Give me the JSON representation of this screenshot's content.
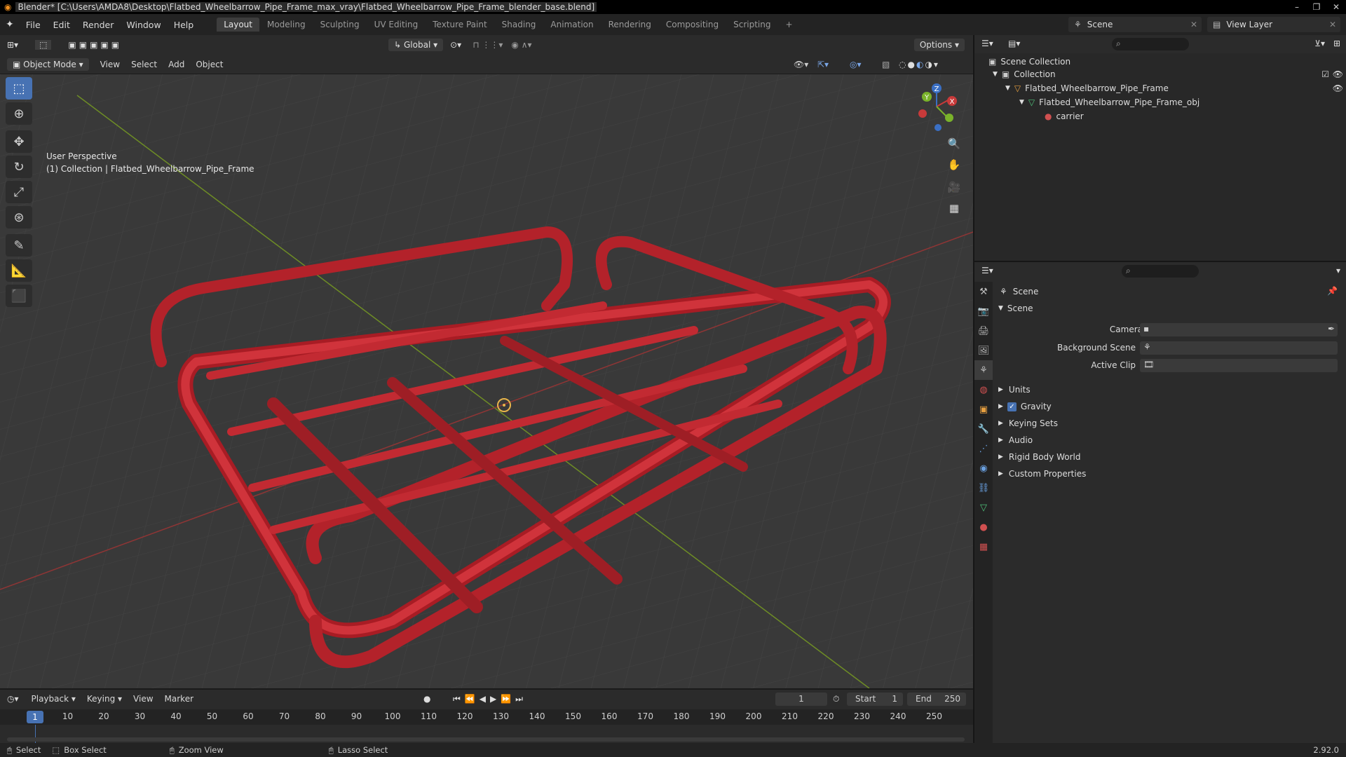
{
  "window": {
    "title": "Blender* [C:\\Users\\AMDA8\\Desktop\\Flatbed_Wheelbarrow_Pipe_Frame_max_vray\\Flatbed_Wheelbarrow_Pipe_Frame_blender_base.blend]",
    "buttons": [
      "–",
      "❐",
      "✕"
    ]
  },
  "menu": {
    "items": [
      "File",
      "Edit",
      "Render",
      "Window",
      "Help"
    ],
    "workspaces": [
      "Layout",
      "Modeling",
      "Sculpting",
      "UV Editing",
      "Texture Paint",
      "Shading",
      "Animation",
      "Rendering",
      "Compositing",
      "Scripting"
    ],
    "add_workspace": "+"
  },
  "scene_selector": {
    "value": "Scene"
  },
  "view_layer_selector": {
    "value": "View Layer"
  },
  "toolbar": {
    "orientation": "Global",
    "options": "Options"
  },
  "viewport_header": {
    "mode": "Object Mode",
    "menus": [
      "View",
      "Select",
      "Add",
      "Object"
    ]
  },
  "viewport": {
    "perspective": "User Perspective",
    "collection_info": "(1) Collection | Flatbed_Wheelbarrow_Pipe_Frame",
    "gizmo": {
      "x": "X",
      "y": "Y",
      "z": "Z"
    }
  },
  "outliner": {
    "root": "Scene Collection",
    "collection": "Collection",
    "object": "Flatbed_Wheelbarrow_Pipe_Frame",
    "mesh": "Flatbed_Wheelbarrow_Pipe_Frame_obj",
    "material": "carrier"
  },
  "properties": {
    "header": "Scene",
    "panel_scene": "Scene",
    "camera_label": "Camera",
    "background_scene_label": "Background Scene",
    "active_clip_label": "Active Clip",
    "panels": [
      "Units",
      "Gravity",
      "Keying Sets",
      "Audio",
      "Rigid Body World",
      "Custom Properties"
    ],
    "gravity_checked": true
  },
  "timeline": {
    "menus": [
      "Playback",
      "Keying",
      "View",
      "Marker"
    ],
    "current_frame": "1",
    "start_label": "Start",
    "start": "1",
    "end_label": "End",
    "end": "250",
    "ticks": [
      "10",
      "20",
      "30",
      "40",
      "50",
      "60",
      "70",
      "80",
      "90",
      "100",
      "110",
      "120",
      "130",
      "140",
      "150",
      "160",
      "170",
      "180",
      "190",
      "200",
      "210",
      "220",
      "230",
      "240",
      "250"
    ],
    "ruler_current": "1"
  },
  "statusbar": {
    "select": "Select",
    "box_select": "Box Select",
    "zoom_view": "Zoom View",
    "lasso_select": "Lasso Select",
    "version": "2.92.0"
  },
  "colors": {
    "accent": "#4772b3",
    "frame": "#c8232b",
    "axis_x": "#b03030",
    "axis_y": "#7ea12a"
  }
}
